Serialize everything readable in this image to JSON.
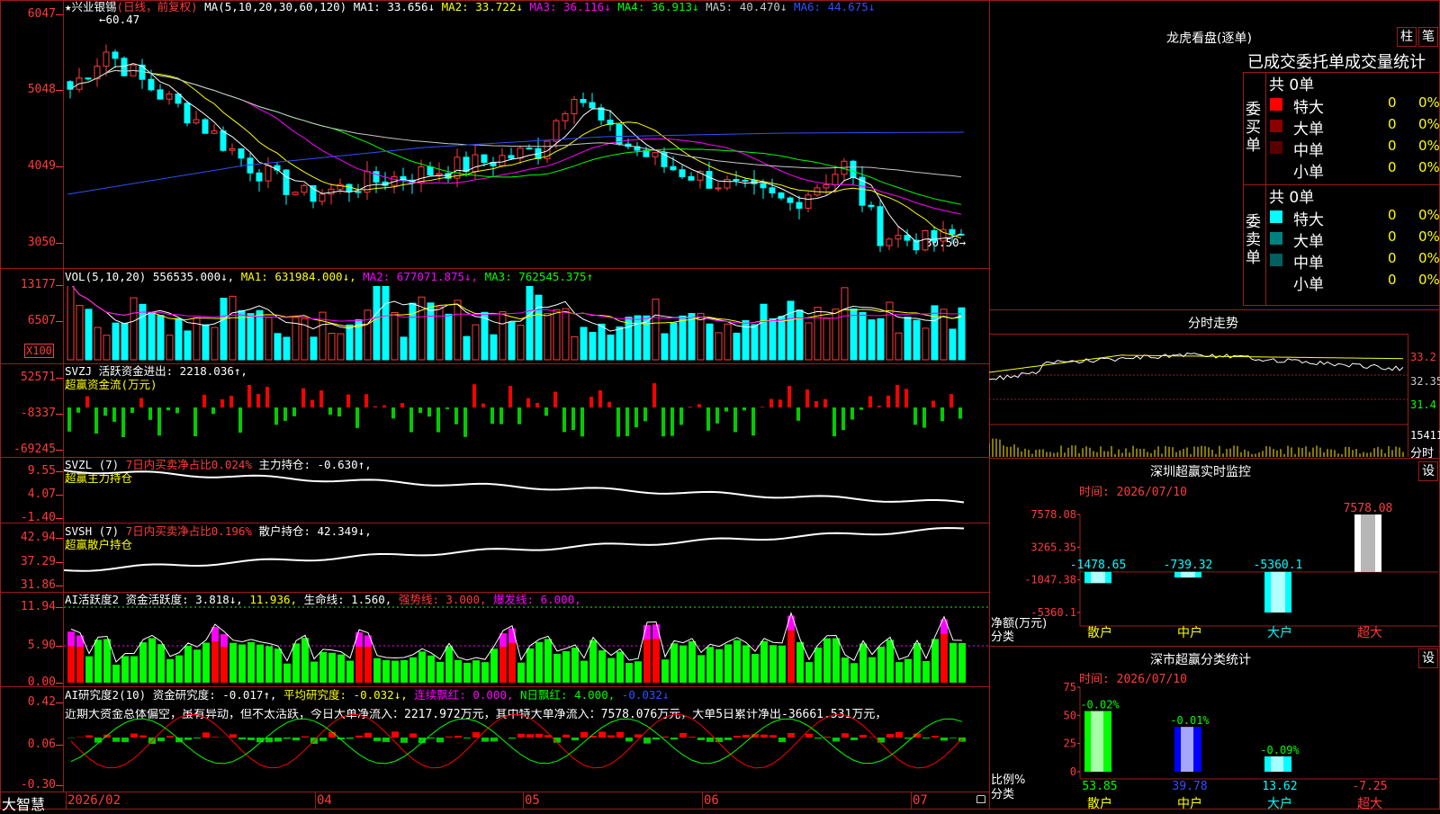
{
  "stock": {
    "name": "兴业银锡",
    "mode": "(日线，前复权)"
  },
  "price_pane": {
    "ma_label": "MA(5,10,20,30,60,120)",
    "ma_items": [
      {
        "label": "MA1: 33.656↓",
        "color": "#ffffff"
      },
      {
        "label": "MA2: 33.722↓",
        "color": "#ffff00"
      },
      {
        "label": "MA3: 36.116↓",
        "color": "#ff00ff"
      },
      {
        "label": "MA4: 36.913↓",
        "color": "#00ff00"
      },
      {
        "label": "MA5: 40.470↓",
        "color": "#c8c8c8"
      },
      {
        "label": "MA6: 44.675↓",
        "color": "#3050ff"
      }
    ],
    "y_ticks": [
      "6047",
      "5048",
      "4049",
      "3050"
    ],
    "high_label": "60.47",
    "low_label": "30.50"
  },
  "vol_pane": {
    "title": "VOL(5,10,20)",
    "items": [
      {
        "label": "556535.000↓,",
        "color": "#ffffff"
      },
      {
        "label": "MA1: 631984.000↓,",
        "color": "#ffff00"
      },
      {
        "label": "MA2: 677071.875↓,",
        "color": "#ff00ff"
      },
      {
        "label": "MA3: 762545.375↑",
        "color": "#00ff00"
      }
    ],
    "y_ticks": [
      "13177",
      "6507"
    ],
    "unit": "X100"
  },
  "svzj_pane": {
    "title": "SVZJ 活跃资金进出: 2218.036↑,",
    "sub": "超赢资金流(万元)",
    "y_ticks": [
      "52571",
      "-8337",
      "-69245"
    ]
  },
  "svzl_pane": {
    "title_a": "SVZL (7)",
    "title_b": "7日内买卖净占比0.024%",
    "title_c": "主力持仓: -0.630↑,",
    "sub": "超赢主力持仓",
    "y_ticks": [
      "9.55",
      "4.07",
      "-1.40"
    ]
  },
  "svsh_pane": {
    "title_a": "SVSH (7)",
    "title_b": "7日内买卖净占比0.196%",
    "title_c": "散户持仓: 42.349↓,",
    "sub": "超赢散户持仓",
    "y_ticks": [
      "42.94",
      "37.29",
      "31.86"
    ]
  },
  "ai_active_pane": {
    "items": [
      {
        "label": "AI活跃度2 资金活跃度: 3.818↓,",
        "color": "#ffffff"
      },
      {
        "label": "11.936,",
        "color": "#ffff00"
      },
      {
        "label": "生命线: 1.560,",
        "color": "#ffffff"
      },
      {
        "label": "强势线: 3.000,",
        "color": "#ff3b3b"
      },
      {
        "label": "爆发线: 6.000,",
        "color": "#ff00ff"
      }
    ],
    "y_ticks": [
      "11.94",
      "5.90",
      "0.00"
    ]
  },
  "ai_research_pane": {
    "items": [
      {
        "label": "AI研究度2(10) 资金研究度: -0.017↑,",
        "color": "#ffffff"
      },
      {
        "label": "平均研究度: -0.032↓,",
        "color": "#ffff00"
      },
      {
        "label": "连续飘红: 0.000,",
        "color": "#ff00ff"
      },
      {
        "label": "N日飘红: 4.000,",
        "color": "#00ff00"
      },
      {
        "label": "-0.032↓",
        "color": "#3050ff"
      }
    ],
    "comment": "近期大资金总体偏空，虽有异动，但不太活跃，今日大单净流入：2217.972万元，其中特大单净流入：7578.076万元，大单5日累计净出-36661.531万元，",
    "y_ticks": [
      "0.42",
      "0.06",
      "-0.30"
    ]
  },
  "bottom_bar": {
    "app": "大智慧",
    "dates": [
      "2026/02",
      "04",
      "05",
      "06",
      "07"
    ]
  },
  "dragon_tiger": {
    "title": "龙虎看盘(逐单)",
    "btn_bar": "柱",
    "btn_pen": "笔",
    "subtitle": "已成交委托单成交量统计",
    "buy": {
      "side": "委买单",
      "total": "共 0单",
      "rows": [
        {
          "label": "特大",
          "count": "0",
          "pct": "0%",
          "color": "#ff0000"
        },
        {
          "label": "大单",
          "count": "0",
          "pct": "0%",
          "color": "#8b0000"
        },
        {
          "label": "中单",
          "count": "0",
          "pct": "0%",
          "color": "#5a0000"
        },
        {
          "label": "小单",
          "count": "0",
          "pct": "0%",
          "color": ""
        }
      ]
    },
    "sell": {
      "side": "委卖单",
      "total": "共 0单",
      "rows": [
        {
          "label": "特大",
          "count": "0",
          "pct": "0%",
          "color": "#00ffff"
        },
        {
          "label": "大单",
          "count": "0",
          "pct": "0%",
          "color": "#008080"
        },
        {
          "label": "中单",
          "count": "0",
          "pct": "0%",
          "color": "#006060"
        },
        {
          "label": "小单",
          "count": "0",
          "pct": "0%",
          "color": ""
        }
      ]
    }
  },
  "intraday": {
    "title": "分时走势",
    "prices": [
      "33.2",
      "32.35",
      "31.4"
    ],
    "vol": "15411",
    "unit": "分时"
  },
  "monitor": {
    "title": "深圳超赢实时监控",
    "btn": "设",
    "time": "时间: 2026/07/10",
    "y_ticks": [
      "7578.08",
      "3265.35",
      "-1047.38",
      "-5360.1"
    ],
    "y_title": "净额(万元)",
    "x_title": "分类"
  },
  "stats": {
    "title": "深市超赢分类统计",
    "btn": "设",
    "time": "时间: 2026/07/10",
    "y_ticks": [
      "75",
      "50",
      "25",
      "0"
    ],
    "y_title": "比例%",
    "x_title": "分类"
  },
  "chart_data": [
    {
      "type": "bar",
      "title": "深圳超赢实时监控",
      "ylabel": "净额(万元)",
      "categories": [
        "散户",
        "中户",
        "大户",
        "超大"
      ],
      "values": [
        -1478.65,
        -739.32,
        -5360.1,
        7578.08
      ],
      "ylim": [
        -5360.1,
        7578.08
      ]
    },
    {
      "type": "bar",
      "title": "深市超赢分类统计",
      "ylabel": "比例%",
      "categories": [
        "散户",
        "中户",
        "大户",
        "超大"
      ],
      "values": [
        53.85,
        39.78,
        13.62,
        -7.25
      ],
      "changes": [
        "-0.02%",
        "-0.01%",
        "-0.09%",
        ""
      ],
      "ylim": [
        0,
        75
      ]
    }
  ]
}
